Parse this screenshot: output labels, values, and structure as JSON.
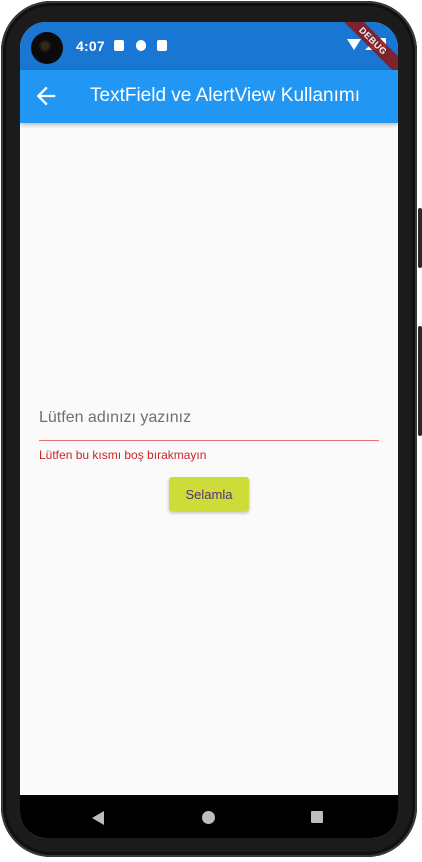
{
  "status_bar": {
    "time": "4:07",
    "notification_icons": [
      "a-icon",
      "p-icon",
      "sd-card-icon"
    ],
    "system_icons": [
      "wifi-icon",
      "signal-icon",
      "battery-icon"
    ],
    "debug_banner": "DEBUG",
    "color": "#1976d2"
  },
  "app_bar": {
    "title": "TextField ve AlertView Kullanımı",
    "back_icon": "arrow-back-icon",
    "color": "#2196f3"
  },
  "form": {
    "input": {
      "placeholder": "Lütfen adınızı yazınız",
      "value": ""
    },
    "error_text": "Lütfen bu kısmı boş bırakmayın",
    "error_color": "#c62828",
    "submit_label": "Selamla",
    "button_color": "#cddc39",
    "button_text_color": "#5a2d82"
  },
  "nav_bar": {
    "buttons": [
      "back-icon",
      "home-icon",
      "recents-icon"
    ]
  }
}
